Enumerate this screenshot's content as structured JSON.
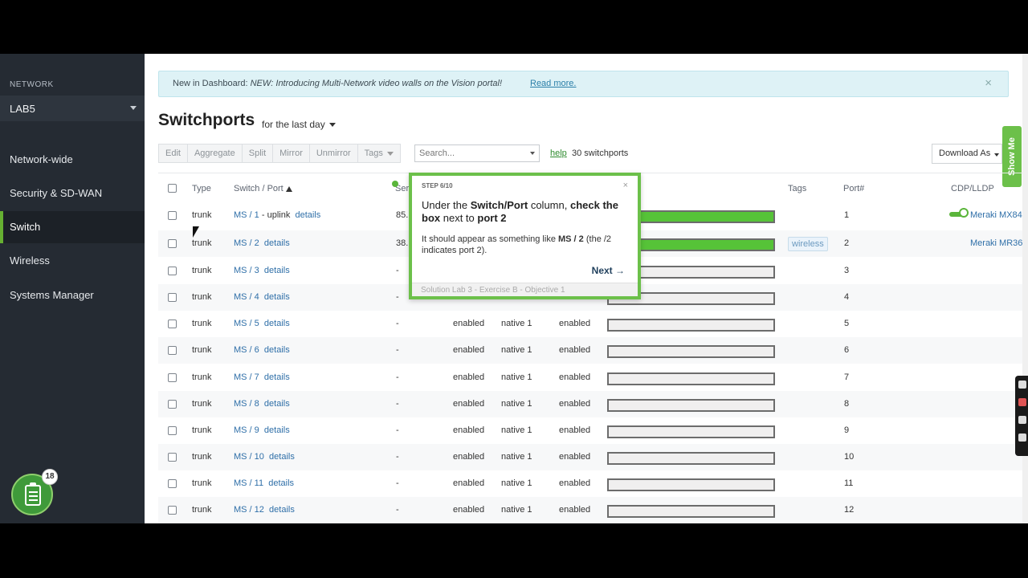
{
  "sidebar": {
    "network_label": "NETWORK",
    "network_value": "LAB5",
    "items": [
      {
        "label": "Network-wide"
      },
      {
        "label": "Security & SD-WAN"
      },
      {
        "label": "Switch"
      },
      {
        "label": "Wireless"
      },
      {
        "label": "Systems Manager"
      }
    ],
    "help_badge": "18"
  },
  "banner": {
    "prefix": "New in Dashboard: ",
    "message": "NEW: Introducing Multi-Network video walls on the Vision portal!",
    "link": "Read more.",
    "close": "×"
  },
  "page": {
    "title": "Switchports",
    "period": "for the last day"
  },
  "toolbar": {
    "buttons": [
      "Edit",
      "Aggregate",
      "Split",
      "Mirror",
      "Unmirror",
      "Tags"
    ],
    "search_placeholder": "Search...",
    "help": "help",
    "count": "30 switchports",
    "download": "Download As",
    "show_me": "Show Me"
  },
  "table": {
    "headers": {
      "type": "Type",
      "switch_port": "Switch / Port",
      "ser": "Ser",
      "tags": "Tags",
      "port_num": "Port#",
      "cdp": "CDP/LLDP"
    },
    "rows": [
      {
        "type": "trunk",
        "port": "MS / 1",
        "extra": "- uplink",
        "details": "details",
        "c1": "85.",
        "c2": "",
        "c3": "",
        "c4": "",
        "usage": 1.0,
        "tag": "",
        "num": "1",
        "cdp": "Meraki MX84"
      },
      {
        "type": "trunk",
        "port": "MS / 2",
        "extra": "",
        "details": "details",
        "c1": "38.",
        "c2": "",
        "c3": "",
        "c4": "",
        "usage": 1.0,
        "tag": "wireless",
        "num": "2",
        "cdp": "Meraki MR36"
      },
      {
        "type": "trunk",
        "port": "MS / 3",
        "extra": "",
        "details": "details",
        "c1": "-",
        "c2": "",
        "c3": "",
        "c4": "",
        "usage": 0,
        "tag": "",
        "num": "3",
        "cdp": ""
      },
      {
        "type": "trunk",
        "port": "MS / 4",
        "extra": "",
        "details": "details",
        "c1": "-",
        "c2": "",
        "c3": "",
        "c4": "",
        "usage": 0,
        "tag": "",
        "num": "4",
        "cdp": ""
      },
      {
        "type": "trunk",
        "port": "MS / 5",
        "extra": "",
        "details": "details",
        "c1": "-",
        "c2": "enabled",
        "c3": "native 1",
        "c4": "enabled",
        "usage": 0,
        "tag": "",
        "num": "5",
        "cdp": ""
      },
      {
        "type": "trunk",
        "port": "MS / 6",
        "extra": "",
        "details": "details",
        "c1": "-",
        "c2": "enabled",
        "c3": "native 1",
        "c4": "enabled",
        "usage": 0,
        "tag": "",
        "num": "6",
        "cdp": ""
      },
      {
        "type": "trunk",
        "port": "MS / 7",
        "extra": "",
        "details": "details",
        "c1": "-",
        "c2": "enabled",
        "c3": "native 1",
        "c4": "enabled",
        "usage": 0,
        "tag": "",
        "num": "7",
        "cdp": ""
      },
      {
        "type": "trunk",
        "port": "MS / 8",
        "extra": "",
        "details": "details",
        "c1": "-",
        "c2": "enabled",
        "c3": "native 1",
        "c4": "enabled",
        "usage": 0,
        "tag": "",
        "num": "8",
        "cdp": ""
      },
      {
        "type": "trunk",
        "port": "MS / 9",
        "extra": "",
        "details": "details",
        "c1": "-",
        "c2": "enabled",
        "c3": "native 1",
        "c4": "enabled",
        "usage": 0,
        "tag": "",
        "num": "9",
        "cdp": ""
      },
      {
        "type": "trunk",
        "port": "MS / 10",
        "extra": "",
        "details": "details",
        "c1": "-",
        "c2": "enabled",
        "c3": "native 1",
        "c4": "enabled",
        "usage": 0,
        "tag": "",
        "num": "10",
        "cdp": ""
      },
      {
        "type": "trunk",
        "port": "MS / 11",
        "extra": "",
        "details": "details",
        "c1": "-",
        "c2": "enabled",
        "c3": "native 1",
        "c4": "enabled",
        "usage": 0,
        "tag": "",
        "num": "11",
        "cdp": ""
      },
      {
        "type": "trunk",
        "port": "MS / 12",
        "extra": "",
        "details": "details",
        "c1": "-",
        "c2": "enabled",
        "c3": "native 1",
        "c4": "enabled",
        "usage": 0,
        "tag": "",
        "num": "12",
        "cdp": ""
      }
    ]
  },
  "tooltip": {
    "step": "STEP 6/10",
    "close": "×",
    "h_1": "Under the ",
    "h_2": "Switch/Port",
    "h_3": " column, ",
    "h_4": "check the box",
    "h_5": " next to ",
    "h_6": "port 2",
    "p_1": "It should appear as something like ",
    "p_2": "MS / 2",
    "p_3": " (the /2 indicates port 2).",
    "next": "Next →",
    "footer": "Solution Lab 3 - Exercise B - Objective 1"
  },
  "colors": {
    "sidebar_bg": "#252b33",
    "accent_green": "#66b032",
    "link_blue": "#2f6fa8",
    "banner_bg": "#def2f6"
  }
}
